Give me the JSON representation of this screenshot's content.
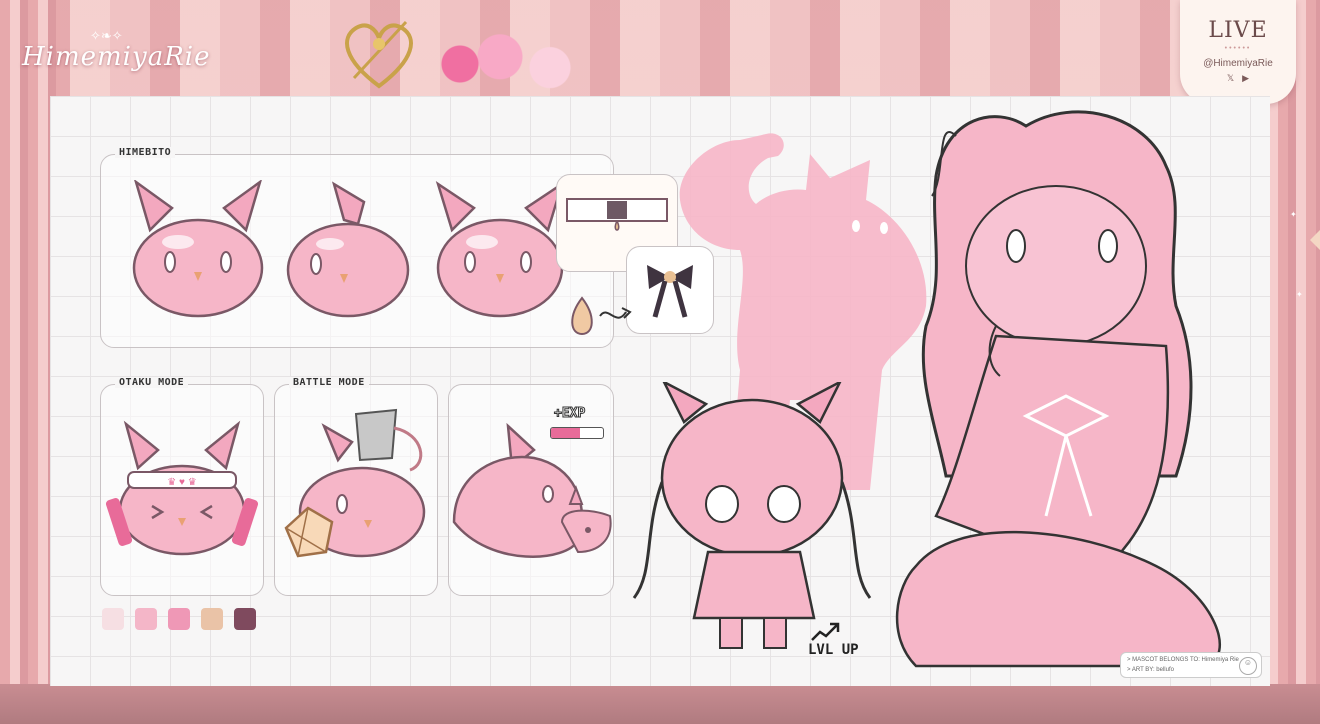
{
  "brand": {
    "name": "HimemiyaRie",
    "crown": "✧❧✧"
  },
  "live_card": {
    "title": "LIVE",
    "dots": "••••••",
    "handle": "@HimemiyaRie",
    "x_icon": "𝕏",
    "youtube_icon": "▶"
  },
  "board": {
    "himebito": {
      "label": "HIMEBITO"
    },
    "otaku": {
      "label": "OTAKU MODE"
    },
    "battle": {
      "label": "BATTLE MODE"
    },
    "exp": {
      "label": "+EXP",
      "fill_fraction": 0.55
    },
    "level_up": "LVL UP",
    "palette": [
      "#f6dfe3",
      "#f4b6c8",
      "#ef98b6",
      "#eac3a7",
      "#7f4a5e"
    ],
    "credit": {
      "line1": "> MASCOT BELONGS TO: Himemiya Rie",
      "line2": "> ART BY: bellufo",
      "icon": "☺"
    }
  },
  "colors": {
    "slime": "#f6b6c8",
    "slime_shade": "#f09ab4",
    "accent": "#e86b99"
  }
}
